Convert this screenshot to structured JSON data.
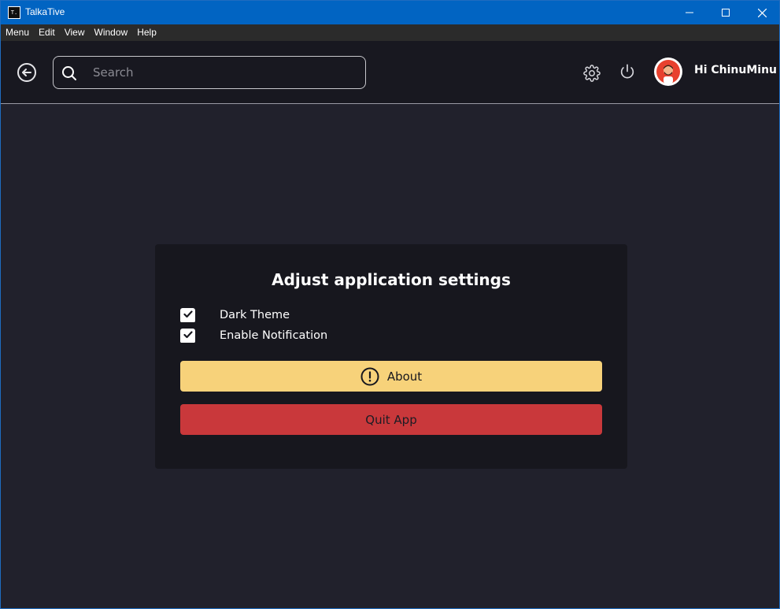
{
  "window": {
    "title": "TalkaTive",
    "icon_text": "T."
  },
  "menubar": {
    "items": [
      "Menu",
      "Edit",
      "View",
      "Window",
      "Help"
    ]
  },
  "header": {
    "search_placeholder": "Search",
    "greeting": "Hi ChinuMinu",
    "back_icon": "arrow-left-circle-icon",
    "settings_icon": "gear-icon",
    "logout_icon": "power-icon"
  },
  "settings": {
    "title": "Adjust application settings",
    "options": [
      {
        "label": "Dark Theme",
        "checked": true
      },
      {
        "label": "Enable Notification",
        "checked": true
      }
    ],
    "about_label": "About",
    "quit_label": "Quit App"
  },
  "colors": {
    "titlebar": "#0164c2",
    "background": "#21212c",
    "header": "#181820",
    "card": "#17171e",
    "about_button": "#f7d27a",
    "quit_button": "#c9383b"
  }
}
